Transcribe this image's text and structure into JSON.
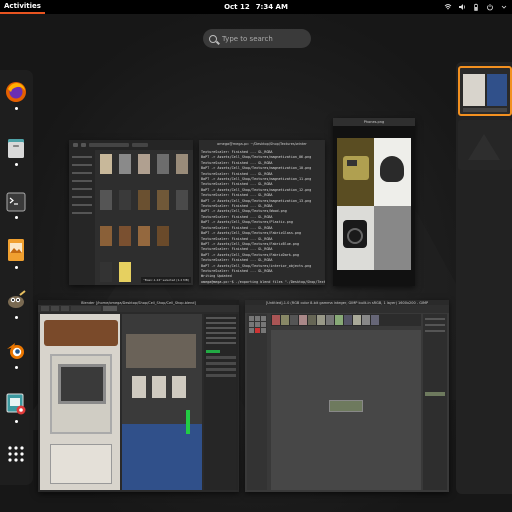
{
  "topbar": {
    "activities_label": "Activities",
    "date": "Oct 12",
    "time": "7:34 AM",
    "tray_icons": [
      "network-icon",
      "volume-icon",
      "battery-icon",
      "power-icon",
      "menu-arrow-icon"
    ]
  },
  "search": {
    "placeholder": "Type to search"
  },
  "dock": {
    "items": [
      {
        "name": "firefox",
        "icon": "firefox-icon",
        "running": true
      },
      {
        "name": "files",
        "icon": "files-icon",
        "running": true
      },
      {
        "name": "terminal",
        "icon": "terminal-icon",
        "running": true
      },
      {
        "name": "image-viewer",
        "icon": "image-viewer-icon",
        "running": true
      },
      {
        "name": "gimp",
        "icon": "gimp-icon",
        "running": true
      },
      {
        "name": "blender",
        "icon": "blender-icon",
        "running": true
      },
      {
        "name": "screenshot",
        "icon": "screenshot-icon",
        "running": true
      },
      {
        "name": "show-apps",
        "icon": "app-grid-icon",
        "running": false
      }
    ]
  },
  "windows": {
    "file_manager": {
      "status": "\"Basic.1.24\" selected (1.2 MB)"
    },
    "terminal": {
      "title": "omega@mega-pc: ~/Desktop/Shop/Textures/winter",
      "lines": [
        "TextureScaler: Finished --- GL_RGBA",
        "BaPT -> Assets/Cell_Shop/Textures/magnetization_06.png",
        "TextureScaler: Finished --- GL_RGBA",
        "BaPT -> Assets/Cell_Shop/Textures/magnetization_10.png",
        "TextureScaler: Finished --- GL_RGBA",
        "BaPT -> Assets/Cell_Shop/Textures/magnetization_11.png",
        "TextureScaler: Finished --- GL_RGBA",
        "BaPT -> Assets/Cell_Shop/Textures/magnetization_12.png",
        "TextureScaler: Finished --- GL_RGBA",
        "BaPT -> Assets/Cell_Shop/Textures/magnetization_13.png",
        "TextureScaler: Finished --- GL_RGBA",
        "BaPT -> Assets/Cell_Shop/Textures/Wood.png",
        "TextureScaler: Finished --- GL_RGBA",
        "BaPT -> Assets/Cell_Shop/Textures/Plastic.png",
        "TextureScaler: Finished --- GL_RGBA",
        "BaPT -> Assets/Cell_Shop/Textures/FabricGlass.png",
        "TextureScaler: Finished --- GL_RGBA",
        "BaPT -> Assets/Cell_Shop/Textures/FabricBlue.png",
        "TextureScaler: Finished --- GL_RGBA",
        "BaPT -> Assets/Cell_Shop/Textures/FabricDark.png",
        "TextureScaler: Finished --- GL_RGBA",
        "BaPT -> Assets/Cell_Shop/Textures/interior_objects.png",
        "TextureScaler: Finished --- GL_RGBA",
        "Writing Updated"
      ],
      "command": "omega@mega-pc:~$ ./exporting blend files \"./Desktop/Shop/Textures/pack & Data/0004BE.TF\"",
      "prompt": "omega@mega-pc:~/Desktop/Shop/Textures/winter$"
    },
    "image_viewer": {
      "title": "Phones.png"
    },
    "blender": {
      "title": "Blender [/home/omega/Desktop/Shop/Cell_Shop/Cell_Shop.blend]"
    },
    "gimp": {
      "title": "[Untitled]-1.0 (RGB color 8-bit gamma integer, GIMP built-in sRGB, 1 layer) 1600x200 - GIMP"
    }
  },
  "colors": {
    "accent": "#e95420",
    "topbar": "#000000",
    "dock": "#1e1e1e",
    "workspace_highlight": "#f29020"
  }
}
